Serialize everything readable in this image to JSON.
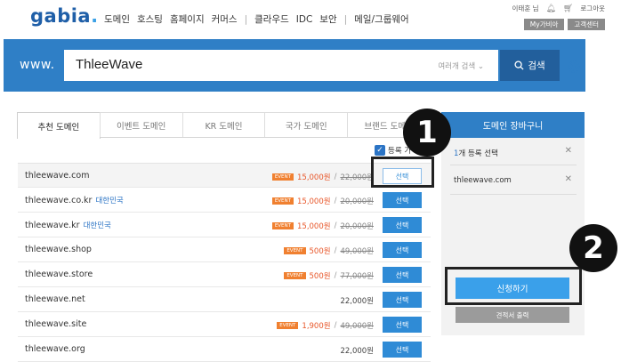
{
  "header": {
    "logo": "gabia",
    "logo_dot": ".",
    "nav": [
      "도메인",
      "호스팅",
      "홈페이지",
      "커머스",
      "클라우드",
      "IDC",
      "보안",
      "메일/그룹웨어"
    ],
    "user": "이태훈 님",
    "logout": "로그아웃",
    "mygabia": "My가비아",
    "support": "고객센터"
  },
  "search": {
    "prefix": "www.",
    "value": "ThleeWave",
    "select": "여러개 검색",
    "button": "검색"
  },
  "tabs": [
    "추천 도메인",
    "이벤트 도메인",
    "KR 도메인",
    "국가 도메인",
    "브랜드 도메인"
  ],
  "check_all_label": "등록 가",
  "domains": [
    {
      "name": "thleewave.com",
      "kr": "",
      "event": "EVENT",
      "sale": "15,000원",
      "orig": "22,000원",
      "price": "",
      "btn": "선택"
    },
    {
      "name": "thleewave.co.kr",
      "kr": "대한민국",
      "event": "EVENT",
      "sale": "15,000원",
      "orig": "20,000원",
      "price": "",
      "btn": "선택"
    },
    {
      "name": "thleewave.kr",
      "kr": "대한민국",
      "event": "EVENT",
      "sale": "15,000원",
      "orig": "20,000원",
      "price": "",
      "btn": "선택"
    },
    {
      "name": "thleewave.shop",
      "kr": "",
      "event": "EVENT",
      "sale": "500원",
      "orig": "49,000원",
      "price": "",
      "btn": "선택"
    },
    {
      "name": "thleewave.store",
      "kr": "",
      "event": "EVENT",
      "sale": "500원",
      "orig": "77,000원",
      "price": "",
      "btn": "선택"
    },
    {
      "name": "thleewave.net",
      "kr": "",
      "event": "",
      "sale": "",
      "orig": "",
      "price": "22,000원",
      "btn": "선택"
    },
    {
      "name": "thleewave.site",
      "kr": "",
      "event": "EVENT",
      "sale": "1,900원",
      "orig": "49,000원",
      "price": "",
      "btn": "선택"
    },
    {
      "name": "thleewave.org",
      "kr": "",
      "event": "",
      "sale": "",
      "orig": "",
      "price": "22,000원",
      "btn": "선택"
    }
  ],
  "cart": {
    "title": "도메인 장바구니",
    "count_num": "1",
    "count_text": "개 등록 선택",
    "item": "thleewave.com",
    "apply": "신청하기",
    "quote": "견적서 출력"
  },
  "annotations": {
    "step1": "1",
    "step2": "2"
  },
  "colors": {
    "brand": "#2f7fc6",
    "accent": "#3aa0ea",
    "event": "#f08030",
    "sale": "#e8572a"
  }
}
